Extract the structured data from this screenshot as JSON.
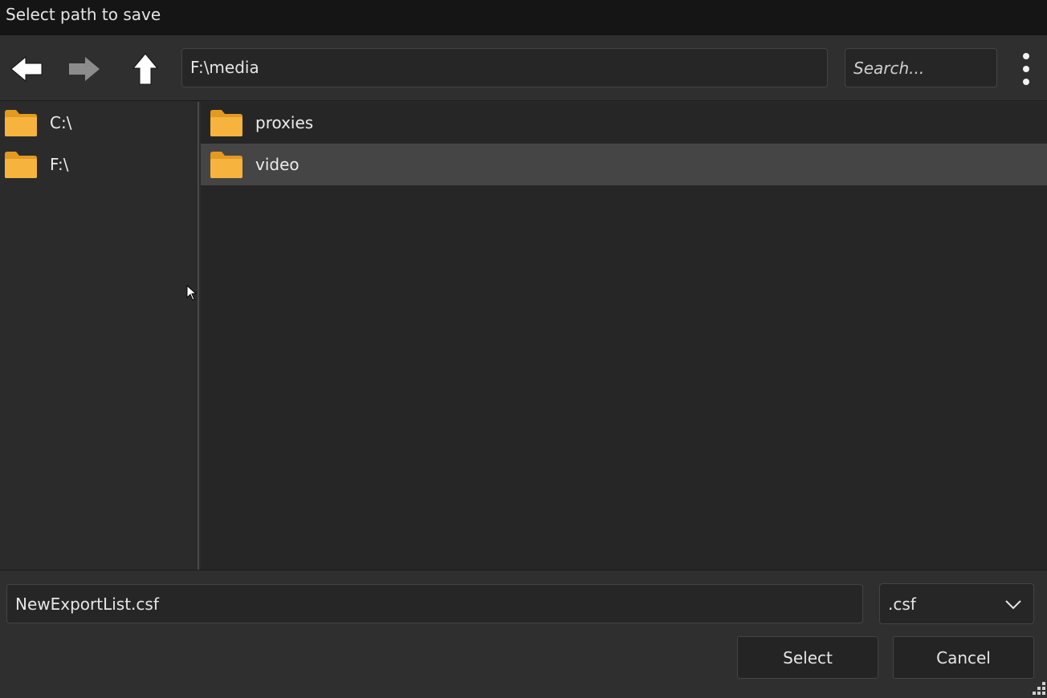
{
  "window": {
    "title": "Select path to save"
  },
  "toolbar": {
    "path_value": "F:\\media",
    "search_placeholder": "Search..."
  },
  "sidebar": {
    "items": [
      {
        "label": "C:\\",
        "icon": "folder-icon"
      },
      {
        "label": "F:\\",
        "icon": "folder-icon"
      }
    ]
  },
  "content": {
    "items": [
      {
        "label": "proxies",
        "icon": "folder-icon",
        "selected": false
      },
      {
        "label": "video",
        "icon": "folder-icon",
        "selected": true
      }
    ]
  },
  "bottom": {
    "filename_value": "NewExportList.csf",
    "filetype_value": ".csf",
    "select_label": "Select",
    "cancel_label": "Cancel"
  },
  "colors": {
    "folder": "#f6b43e",
    "folder_back": "#e39a22",
    "selected_row": "#454545",
    "background": "#2b2b2b"
  }
}
